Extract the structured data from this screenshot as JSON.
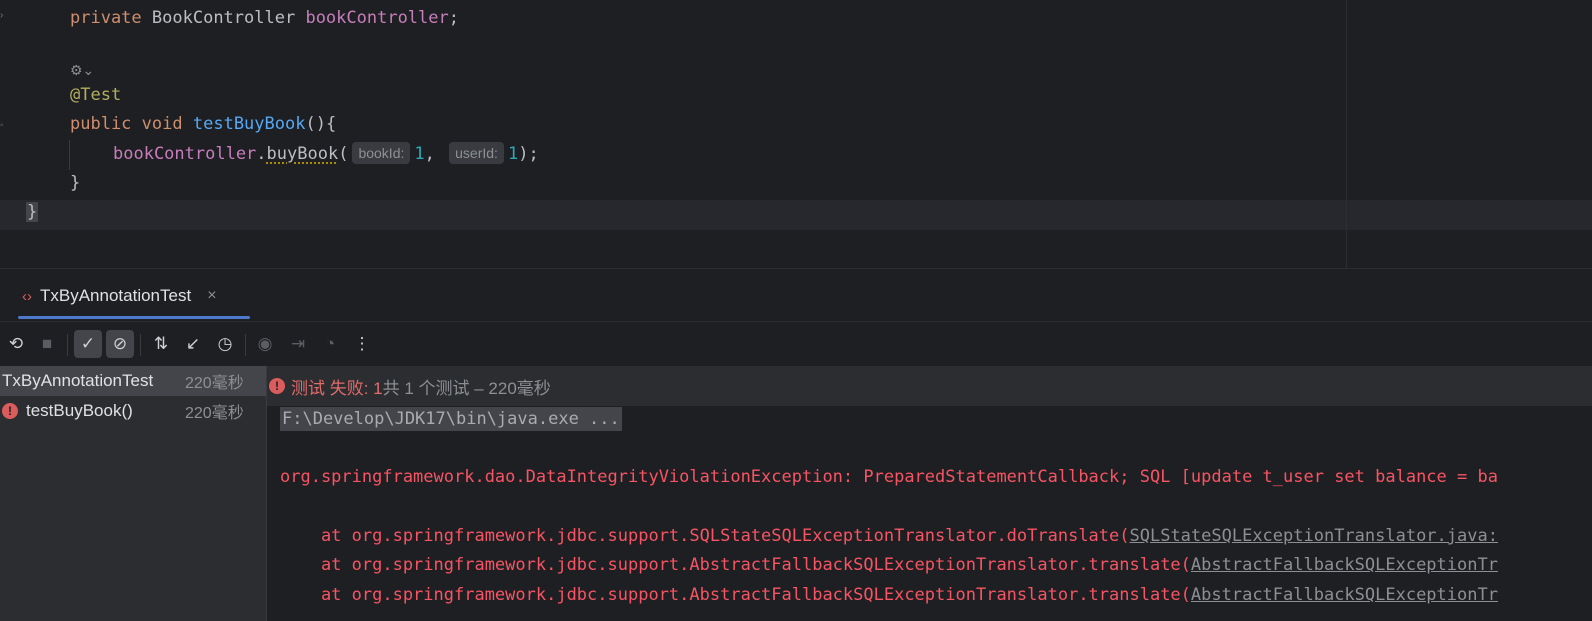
{
  "editor": {
    "line1": {
      "keyword": "private",
      "type": "BookController",
      "field": "bookController",
      "end": ";"
    },
    "annotation": "@Test",
    "line3": {
      "kw1": "public",
      "kw2": "void",
      "method": "testBuyBook",
      "paren": "(){"
    },
    "line4": {
      "object": "bookController",
      "dot": ".",
      "method": "buyBook",
      "open": "(",
      "hint1": "bookId:",
      "arg1": "1",
      "comma": ",",
      "hint2": "userId:",
      "arg2": "1",
      "close": ");"
    },
    "close_method": "}",
    "close_class": "}"
  },
  "tool_window": {
    "tab_label": "TxByAnnotationTest",
    "tab_close": "×"
  },
  "toolbar": {
    "rerun": "⟲",
    "stop": "■",
    "show_passed": "✓",
    "show_ignored": "⊘",
    "sort": "⇅",
    "collapse": "↙",
    "history": "◷",
    "screenshot": "◉",
    "import": "⇥",
    "coverage": "◔",
    "more": "⋮"
  },
  "tree": {
    "root": {
      "label": "TxByAnnotationTest",
      "time": "220毫秒"
    },
    "child": {
      "label": "testBuyBook()",
      "time": "220毫秒",
      "status_icon": "!"
    }
  },
  "console": {
    "status": {
      "icon": "!",
      "fail_text": "测试 失败: 1",
      "rest": "共 1 个测试 – 220毫秒"
    },
    "cmd_line": "F:\\Develop\\JDK17\\bin\\java.exe ...",
    "exception": "org.springframework.dao.DataIntegrityViolationException: PreparedStatementCallback; SQL [update t_user set balance = ba",
    "stack": [
      {
        "prefix": "    at org.springframework.jdbc.support.SQLStateSQLExceptionTranslator.doTranslate(",
        "link": "SQLStateSQLExceptionTranslator.java:"
      },
      {
        "prefix": "    at org.springframework.jdbc.support.AbstractFallbackSQLExceptionTranslator.translate(",
        "link": "AbstractFallbackSQLExceptionTr"
      },
      {
        "prefix": "    at org.springframework.jdbc.support.AbstractFallbackSQLExceptionTranslator.translate(",
        "link": "AbstractFallbackSQLExceptionTr"
      }
    ]
  },
  "colors": {
    "error": "#f75464",
    "accent": "#4d78cc",
    "keyword": "#cf8e6d",
    "method": "#56a8f5",
    "field": "#c77dbb"
  }
}
